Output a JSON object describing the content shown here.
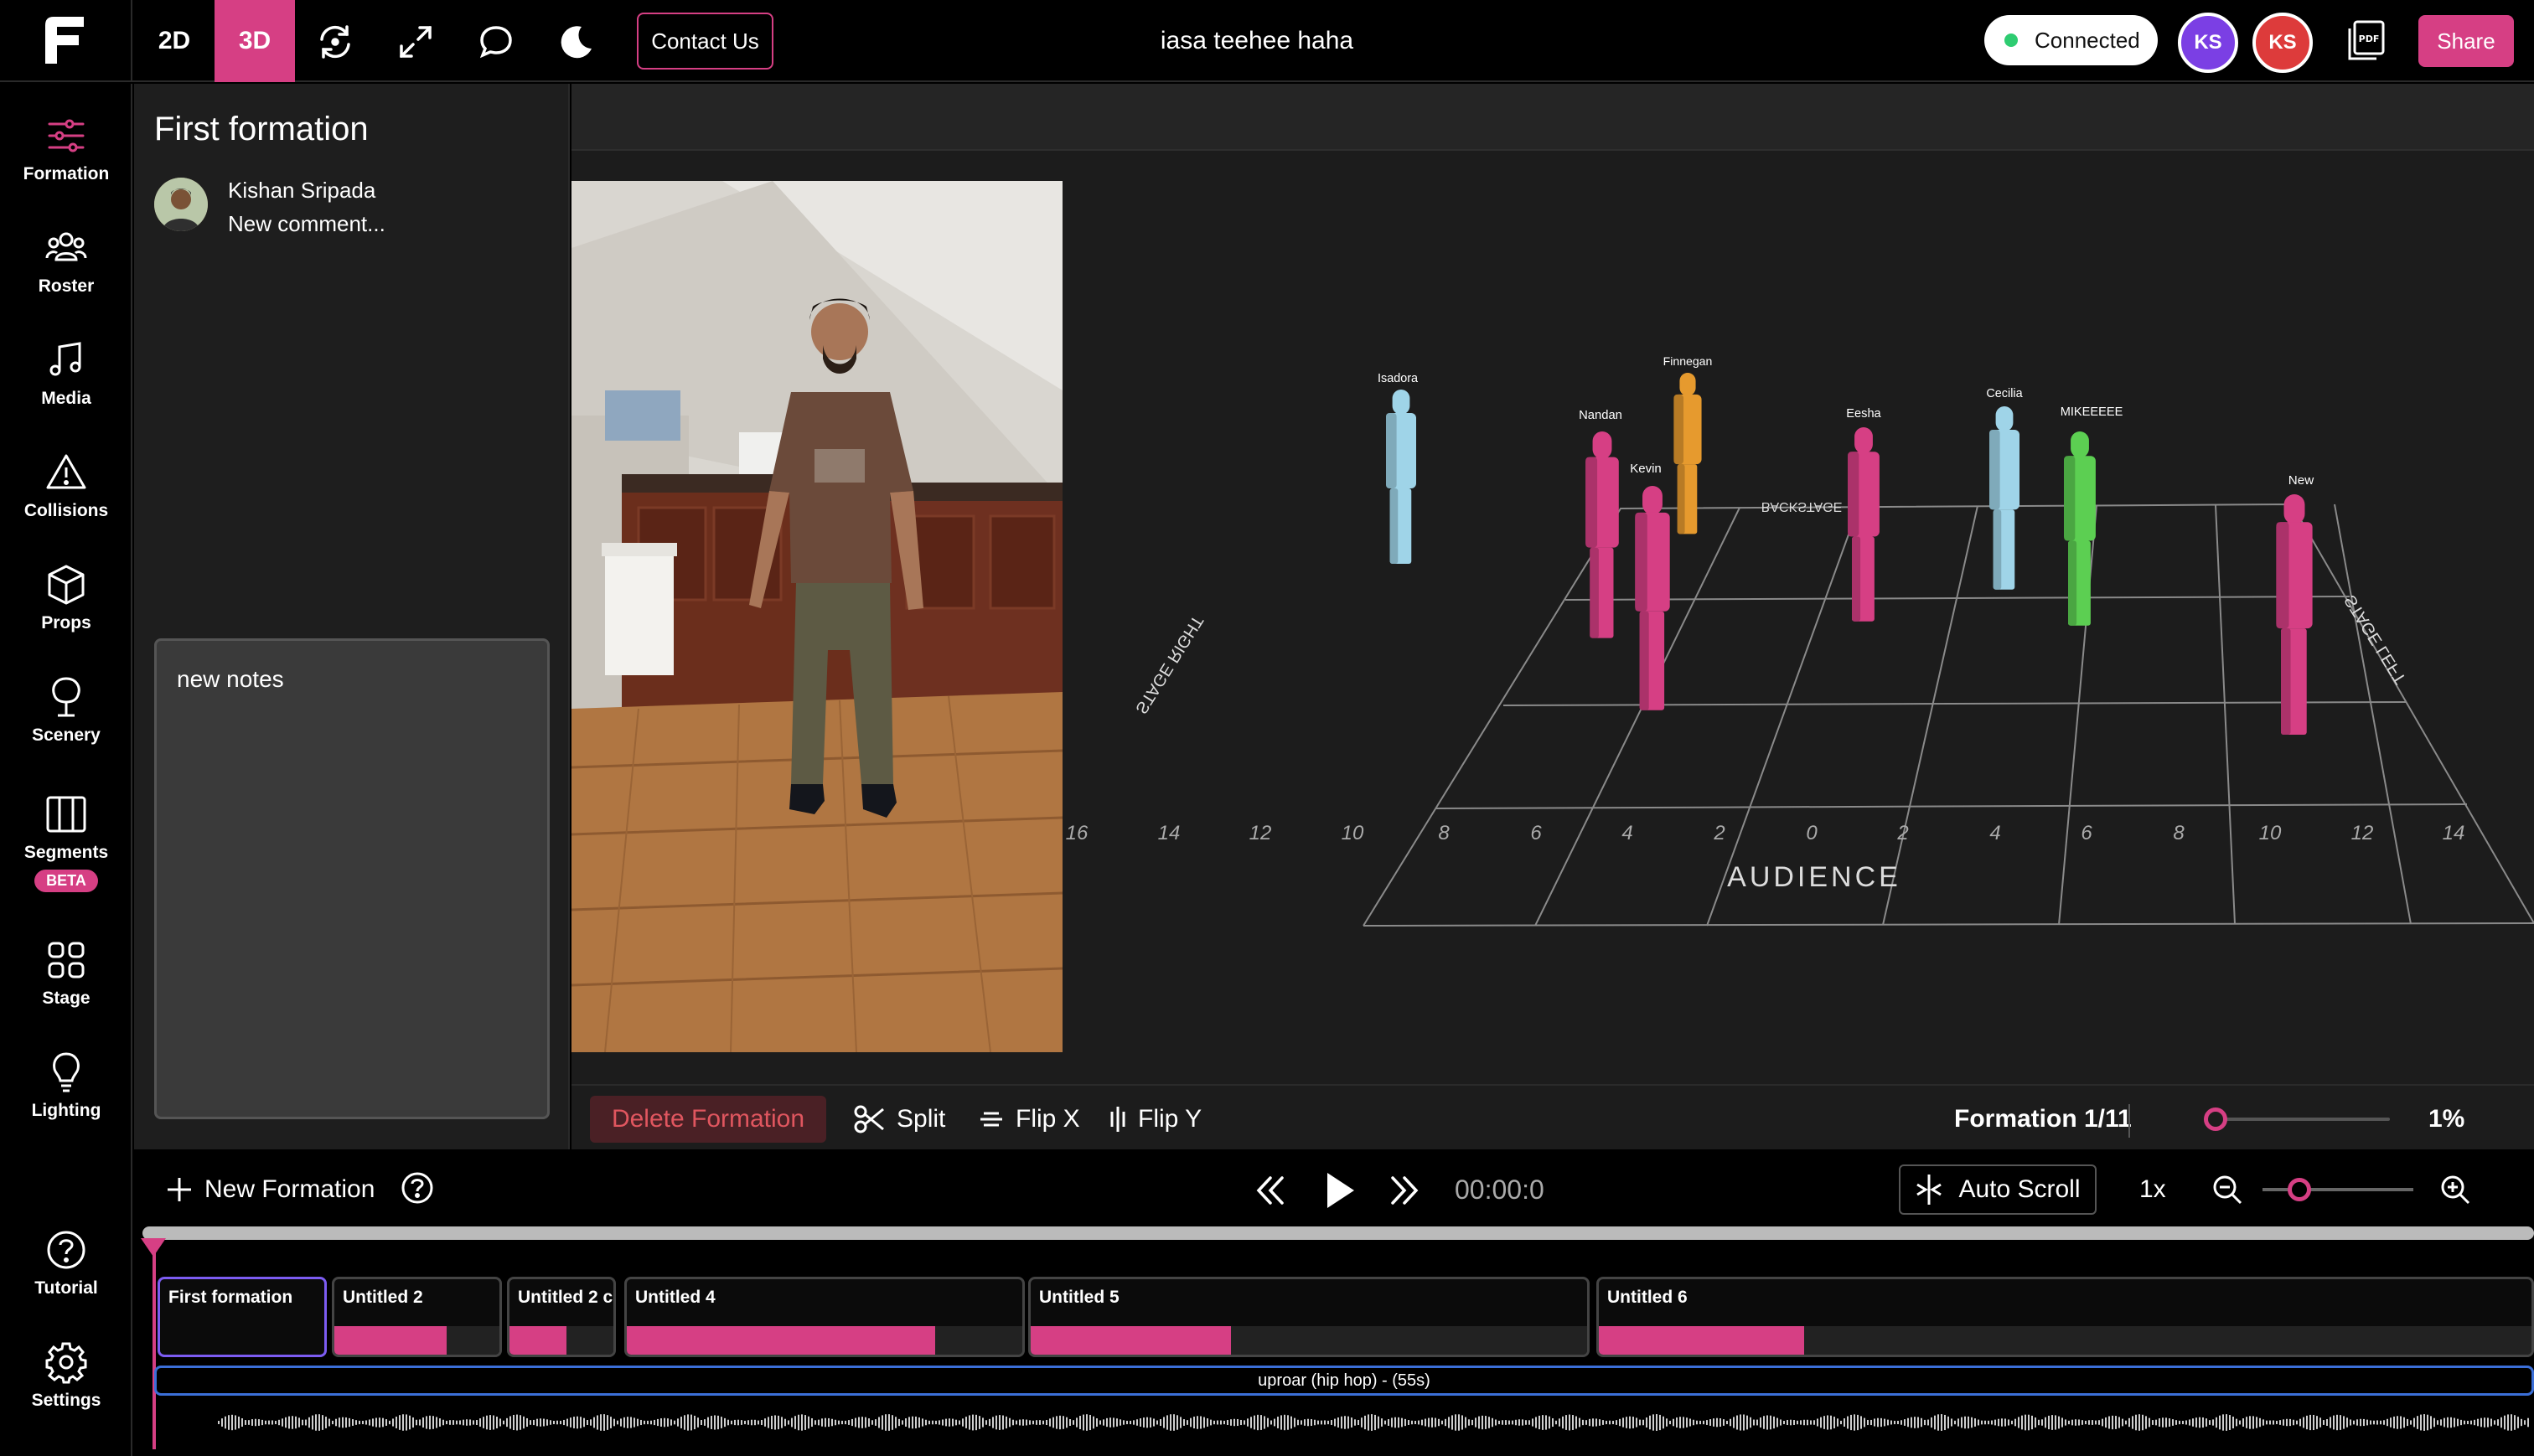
{
  "header": {
    "mode_2d": "2D",
    "mode_3d": "3D",
    "contact_label": "Contact Us",
    "title": "iasa teehee haha",
    "connection_status": "Connected",
    "users": [
      "KS",
      "KS"
    ],
    "pdf_icon": "pdf-icon",
    "share_label": "Share",
    "accent_color": "#d63f84"
  },
  "sidebar": {
    "items": [
      {
        "label": "Formation",
        "icon": "sliders-icon"
      },
      {
        "label": "Roster",
        "icon": "people-icon"
      },
      {
        "label": "Media",
        "icon": "music-icon"
      },
      {
        "label": "Collisions",
        "icon": "warning-icon"
      },
      {
        "label": "Props",
        "icon": "cube-icon"
      },
      {
        "label": "Scenery",
        "icon": "tree-icon"
      },
      {
        "label": "Segments",
        "icon": "columns-icon",
        "badge": "BETA"
      },
      {
        "label": "Stage",
        "icon": "grid-icon"
      },
      {
        "label": "Lighting",
        "icon": "bulb-icon"
      }
    ],
    "bottom": [
      {
        "label": "Tutorial",
        "icon": "help-icon"
      },
      {
        "label": "Settings",
        "icon": "gear-icon"
      }
    ]
  },
  "panel": {
    "title": "First formation",
    "comment_author": "Kishan Sripada",
    "comment_placeholder": "New comment...",
    "notes": "new notes"
  },
  "stage": {
    "audience_label": "AUDIENCE",
    "stage_right_label": "STAGE RIGHT",
    "stage_left_label": "STAGE LEFT",
    "backstage_label": "BACKSTAGE",
    "x_ticks": [
      "16",
      "14",
      "12",
      "10",
      "8",
      "6",
      "4",
      "2",
      "0",
      "2",
      "4",
      "6",
      "8",
      "10",
      "12",
      "14"
    ],
    "dancers": [
      {
        "name": "Isadora",
        "color": "#9fd4e8"
      },
      {
        "name": "Nandan",
        "color": "#d63f84"
      },
      {
        "name": "Kevin",
        "color": "#d63f84"
      },
      {
        "name": "Finnegan",
        "color": "#e69a2e"
      },
      {
        "name": "Eesha",
        "color": "#d63f84"
      },
      {
        "name": "Cecilia",
        "color": "#9fd4e8"
      },
      {
        "name": "MIKEEEEE",
        "color": "#5ccf52"
      },
      {
        "name": "New",
        "color": "#d63f84"
      }
    ]
  },
  "toolbar": {
    "delete_label": "Delete Formation",
    "split_label": "Split",
    "flip_x_label": "Flip X",
    "flip_y_label": "Flip Y",
    "formation_counter": "Formation 1/11",
    "zoom_percent": "1%"
  },
  "timeline": {
    "new_formation_label": "New Formation",
    "timecode": "00:00:0",
    "autoscroll_label": "Auto Scroll",
    "speed": "1x",
    "formations": [
      {
        "name": "First formation",
        "fill": 0
      },
      {
        "name": "Untitled 2",
        "fill": 0.68
      },
      {
        "name": "Untitled 2 c",
        "fill": 0.55
      },
      {
        "name": "Untitled 4",
        "fill": 0.78
      },
      {
        "name": "Untitled 5",
        "fill": 0.36
      },
      {
        "name": "Untitled 6",
        "fill": 0.22
      }
    ],
    "audio_track": "uproar (hip hop) - (55s)"
  }
}
